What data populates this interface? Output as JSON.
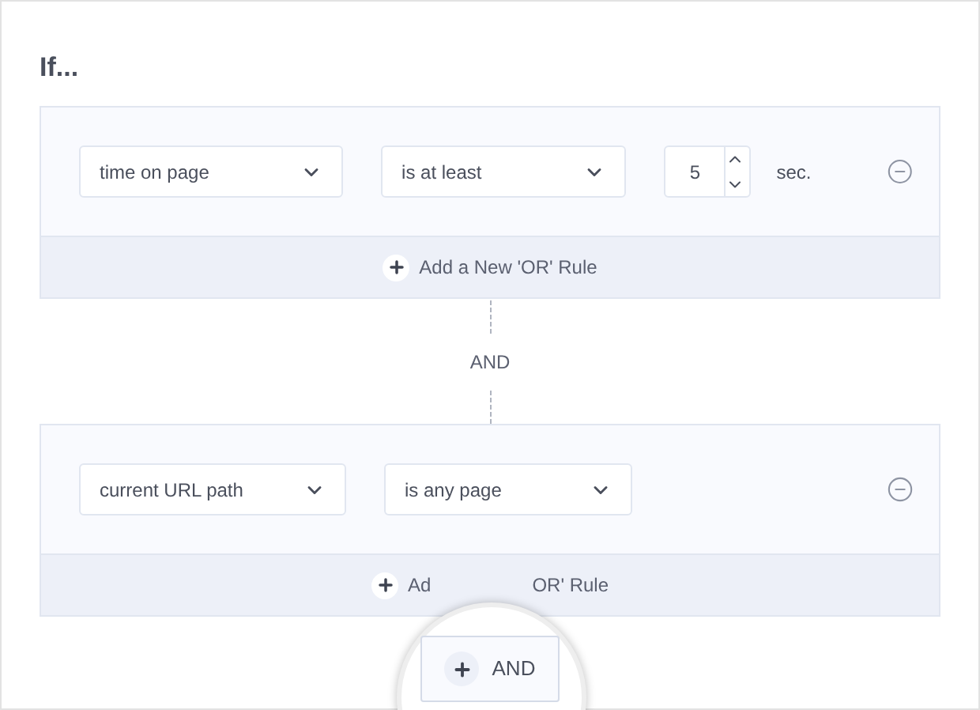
{
  "title": "If...",
  "groups": [
    {
      "rules": [
        {
          "kind": "timed",
          "field": "time on page",
          "operator": "is at least",
          "value": "5",
          "unit": "sec."
        }
      ],
      "add_or": {
        "label_parts": [
          "Add a New 'OR' Rule"
        ]
      }
    },
    {
      "rules": [
        {
          "kind": "plain",
          "field": "current URL path",
          "operator": "is any page"
        }
      ],
      "add_or": {
        "label_parts": [
          "Ad",
          "OR' Rule"
        ]
      }
    }
  ],
  "separator": "AND",
  "add_and": {
    "label": "AND"
  }
}
